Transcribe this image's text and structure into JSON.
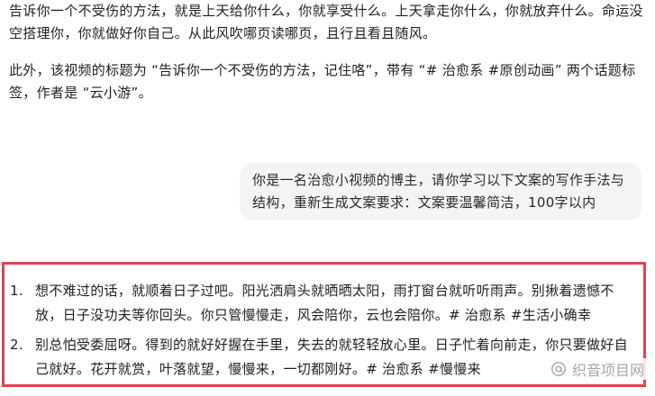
{
  "conversation": {
    "assistant_paragraph_1": "告诉你一个不受伤的方法，就是上天给你什么，你就享受什么。上天拿走你什么，你就放弃什么。命运没空搭理你，你就做好你自己。从此风吹哪页读哪页，且行且看且随风。",
    "assistant_paragraph_2": "此外，该视频的标题为 “告诉你一个不受伤的方法，记住咯”，带有 “# 治愈系 #原创动画” 两个话题标签，作者是 “云小游”。",
    "user_message": "你是一名治愈小视频的博主，请你学习以下文案的写作手法与结构，重新生成文案要求：文案要温馨简洁，100字以内",
    "answer_items": [
      {
        "number": "1.",
        "text": "想不难过的话，就顺着日子过吧。阳光洒肩头就晒晒太阳，雨打窗台就听听雨声。别揪着遗憾不放，日子没功夫等你回头。你只管慢慢走，风会陪你，云也会陪你。# 治愈系 #生活小确幸"
      },
      {
        "number": "2.",
        "text": "别总怕受委屈呀。得到的就好好握在手里，失去的就轻轻放心里。日子忙着向前走，你只要做好自己就好。花开就赏，叶落就望，慢慢来，一切都刚好。# 治愈系 #慢慢来"
      }
    ]
  },
  "watermark": {
    "text": "织音项目网",
    "icon": "at-icon"
  },
  "colors": {
    "highlight_border": "#e0424f",
    "user_bubble_bg": "#f4f4f5",
    "watermark": "#a6a6a6"
  }
}
